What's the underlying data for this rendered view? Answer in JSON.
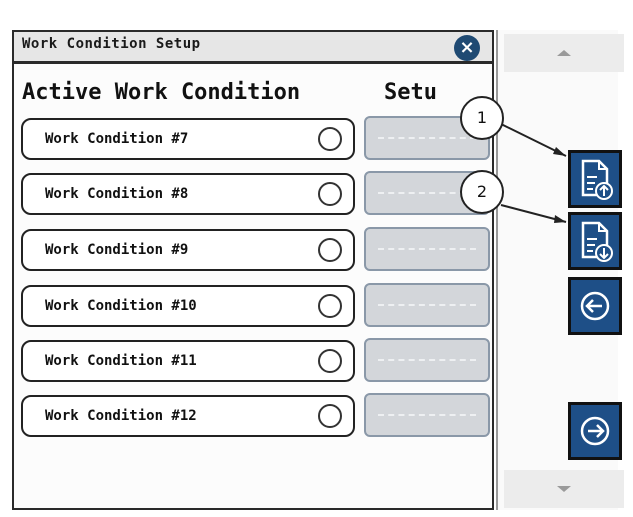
{
  "dialog": {
    "title": "Work Condition Setup",
    "close_icon": "close-icon",
    "headers": {
      "active": "Active Work Condition",
      "setup": "Setu"
    },
    "rows": [
      {
        "label": "Work Condition #7"
      },
      {
        "label": "Work Condition #8"
      },
      {
        "label": "Work Condition #9"
      },
      {
        "label": "Work Condition #10"
      },
      {
        "label": "Work Condition #11"
      },
      {
        "label": "Work Condition #12"
      }
    ]
  },
  "sidebar": {
    "buttons": [
      {
        "icon": "document-upload-icon"
      },
      {
        "icon": "document-download-icon"
      },
      {
        "icon": "arrow-left-icon"
      },
      {
        "icon": "arrow-right-icon"
      }
    ],
    "scroll_icons": [
      "scroll-up-icon",
      "scroll-down-icon"
    ]
  },
  "callouts": [
    "1",
    "2"
  ],
  "colors": {
    "accent": "#1e4f87",
    "setup_box": "#d3d6da"
  }
}
